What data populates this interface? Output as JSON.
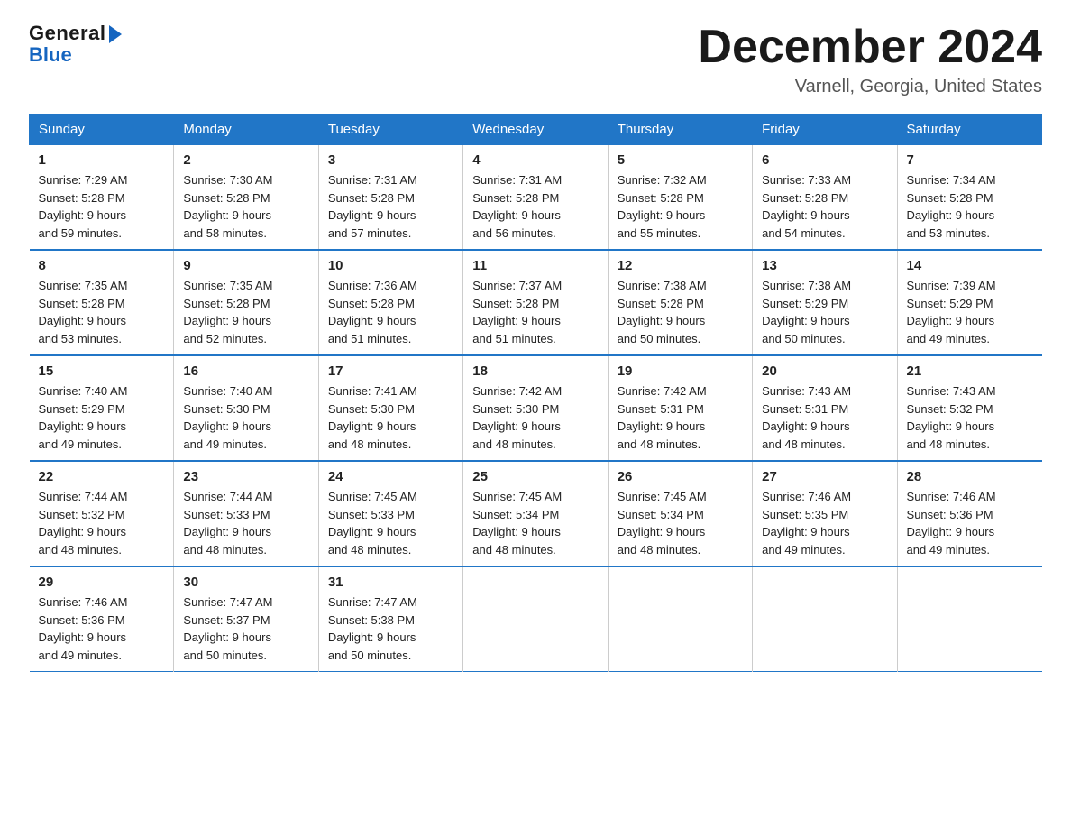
{
  "logo": {
    "general": "General",
    "blue": "Blue"
  },
  "title": "December 2024",
  "location": "Varnell, Georgia, United States",
  "weekdays": [
    "Sunday",
    "Monday",
    "Tuesday",
    "Wednesday",
    "Thursday",
    "Friday",
    "Saturday"
  ],
  "weeks": [
    [
      {
        "day": "1",
        "sunrise": "7:29 AM",
        "sunset": "5:28 PM",
        "daylight": "9 hours and 59 minutes."
      },
      {
        "day": "2",
        "sunrise": "7:30 AM",
        "sunset": "5:28 PM",
        "daylight": "9 hours and 58 minutes."
      },
      {
        "day": "3",
        "sunrise": "7:31 AM",
        "sunset": "5:28 PM",
        "daylight": "9 hours and 57 minutes."
      },
      {
        "day": "4",
        "sunrise": "7:31 AM",
        "sunset": "5:28 PM",
        "daylight": "9 hours and 56 minutes."
      },
      {
        "day": "5",
        "sunrise": "7:32 AM",
        "sunset": "5:28 PM",
        "daylight": "9 hours and 55 minutes."
      },
      {
        "day": "6",
        "sunrise": "7:33 AM",
        "sunset": "5:28 PM",
        "daylight": "9 hours and 54 minutes."
      },
      {
        "day": "7",
        "sunrise": "7:34 AM",
        "sunset": "5:28 PM",
        "daylight": "9 hours and 53 minutes."
      }
    ],
    [
      {
        "day": "8",
        "sunrise": "7:35 AM",
        "sunset": "5:28 PM",
        "daylight": "9 hours and 53 minutes."
      },
      {
        "day": "9",
        "sunrise": "7:35 AM",
        "sunset": "5:28 PM",
        "daylight": "9 hours and 52 minutes."
      },
      {
        "day": "10",
        "sunrise": "7:36 AM",
        "sunset": "5:28 PM",
        "daylight": "9 hours and 51 minutes."
      },
      {
        "day": "11",
        "sunrise": "7:37 AM",
        "sunset": "5:28 PM",
        "daylight": "9 hours and 51 minutes."
      },
      {
        "day": "12",
        "sunrise": "7:38 AM",
        "sunset": "5:28 PM",
        "daylight": "9 hours and 50 minutes."
      },
      {
        "day": "13",
        "sunrise": "7:38 AM",
        "sunset": "5:29 PM",
        "daylight": "9 hours and 50 minutes."
      },
      {
        "day": "14",
        "sunrise": "7:39 AM",
        "sunset": "5:29 PM",
        "daylight": "9 hours and 49 minutes."
      }
    ],
    [
      {
        "day": "15",
        "sunrise": "7:40 AM",
        "sunset": "5:29 PM",
        "daylight": "9 hours and 49 minutes."
      },
      {
        "day": "16",
        "sunrise": "7:40 AM",
        "sunset": "5:30 PM",
        "daylight": "9 hours and 49 minutes."
      },
      {
        "day": "17",
        "sunrise": "7:41 AM",
        "sunset": "5:30 PM",
        "daylight": "9 hours and 48 minutes."
      },
      {
        "day": "18",
        "sunrise": "7:42 AM",
        "sunset": "5:30 PM",
        "daylight": "9 hours and 48 minutes."
      },
      {
        "day": "19",
        "sunrise": "7:42 AM",
        "sunset": "5:31 PM",
        "daylight": "9 hours and 48 minutes."
      },
      {
        "day": "20",
        "sunrise": "7:43 AM",
        "sunset": "5:31 PM",
        "daylight": "9 hours and 48 minutes."
      },
      {
        "day": "21",
        "sunrise": "7:43 AM",
        "sunset": "5:32 PM",
        "daylight": "9 hours and 48 minutes."
      }
    ],
    [
      {
        "day": "22",
        "sunrise": "7:44 AM",
        "sunset": "5:32 PM",
        "daylight": "9 hours and 48 minutes."
      },
      {
        "day": "23",
        "sunrise": "7:44 AM",
        "sunset": "5:33 PM",
        "daylight": "9 hours and 48 minutes."
      },
      {
        "day": "24",
        "sunrise": "7:45 AM",
        "sunset": "5:33 PM",
        "daylight": "9 hours and 48 minutes."
      },
      {
        "day": "25",
        "sunrise": "7:45 AM",
        "sunset": "5:34 PM",
        "daylight": "9 hours and 48 minutes."
      },
      {
        "day": "26",
        "sunrise": "7:45 AM",
        "sunset": "5:34 PM",
        "daylight": "9 hours and 48 minutes."
      },
      {
        "day": "27",
        "sunrise": "7:46 AM",
        "sunset": "5:35 PM",
        "daylight": "9 hours and 49 minutes."
      },
      {
        "day": "28",
        "sunrise": "7:46 AM",
        "sunset": "5:36 PM",
        "daylight": "9 hours and 49 minutes."
      }
    ],
    [
      {
        "day": "29",
        "sunrise": "7:46 AM",
        "sunset": "5:36 PM",
        "daylight": "9 hours and 49 minutes."
      },
      {
        "day": "30",
        "sunrise": "7:47 AM",
        "sunset": "5:37 PM",
        "daylight": "9 hours and 50 minutes."
      },
      {
        "day": "31",
        "sunrise": "7:47 AM",
        "sunset": "5:38 PM",
        "daylight": "9 hours and 50 minutes."
      },
      null,
      null,
      null,
      null
    ]
  ],
  "labels": {
    "sunrise": "Sunrise:",
    "sunset": "Sunset:",
    "daylight": "Daylight:"
  }
}
